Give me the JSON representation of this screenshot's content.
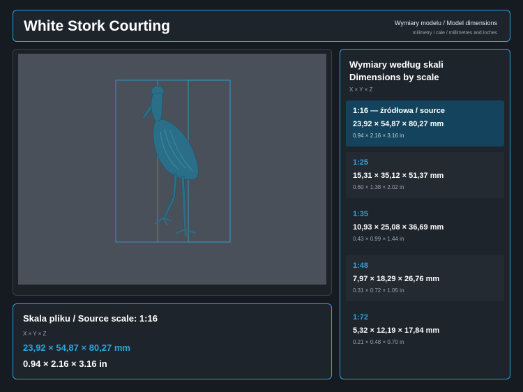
{
  "header": {
    "title": "White Stork Courting",
    "dims_title": "Wymiary modelu / Model dimensions",
    "dims_sub": "milimetry i cale / millimetres and inches"
  },
  "viewer": {
    "model_icon": "stork-3d-model",
    "model_color": "#2b6e87",
    "bbox_color": "#2ea3d8"
  },
  "source": {
    "heading": "Skala pliku / Source scale: 1:16",
    "axes": "X × Y × Z",
    "mm": "23,92 × 54,87 × 80,27 mm",
    "inch": "0.94 × 2.16 × 3.16 in"
  },
  "scales": {
    "heading_pl": "Wymiary według skali",
    "heading_en": "Dimensions by scale",
    "axes": "X × Y × Z",
    "items": [
      {
        "ratio": "1:16  —  źródłowa / source",
        "mm": "23,92 × 54,87 × 80,27 mm",
        "inch": "0.94 × 2.16 × 3.16 in",
        "active": true
      },
      {
        "ratio": "1:25",
        "mm": "15,31 × 35,12 × 51,37 mm",
        "inch": "0.60 × 1.38 × 2.02 in",
        "active": false
      },
      {
        "ratio": "1:35",
        "mm": "10,93 × 25,08 × 36,69 mm",
        "inch": "0.43 × 0.99 × 1.44 in",
        "active": false
      },
      {
        "ratio": "1:48",
        "mm": "7,97 × 18,29 × 26,76 mm",
        "inch": "0.31 × 0.72 × 1.05 in",
        "active": false
      },
      {
        "ratio": "1:72",
        "mm": "5,32 × 12,19 × 17,84 mm",
        "inch": "0.21 × 0.48 × 0.70 in",
        "active": false
      }
    ]
  },
  "colors": {
    "accent": "#2ea3d8",
    "background": "#161b22",
    "panel": "#1e242c",
    "active_card": "#13435d"
  }
}
